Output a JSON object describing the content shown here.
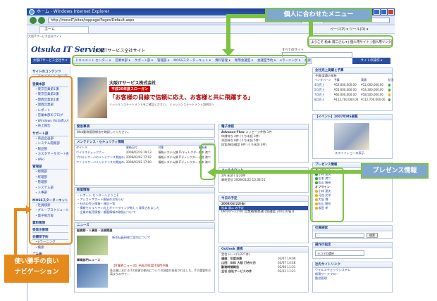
{
  "browser": {
    "title": "ホーム - Windows Internet Explorer",
    "url": "http://mossIT/sites/toppage/Pages/Default.aspx",
    "tab": "ホーム",
    "tools": "ページ(P) ▾  ツール(O) ▾"
  },
  "site": {
    "breadcrumb": "大阪ITサービス全社サイト",
    "logo": "Otsuka IT Service",
    "name": "大阪ITサービス全社サイト",
    "user_menu": "ようこそ 松本 満二さん ▾ | 個人用サイト | 個人用リンク ▾",
    "search_label": "すべてのサイト",
    "home_label": "大阪ITサービス全社サイト",
    "right_button": "サイトの操作 ▾"
  },
  "topnav": [
    "ドキュメント センター ▾",
    "営業本部 ▾",
    "サポート部 ▾",
    "管理部 ▾",
    "MOSSスターターキット ▾",
    "資料管理 ▾",
    "専用会議室 ▾",
    "会議室予約 ▾",
    "eラーニング ▾",
    "検索"
  ],
  "leftnav": [
    {
      "section": "サイトのコンテンツ",
      "items": [
        "ドキュメント センター"
      ]
    },
    {
      "section": "営業本部",
      "items": [
        "東京営業第1課",
        "東京営業第2課",
        "関西営業第1課",
        "関西営業部",
        "レポート",
        "営業本部のブログ",
        "Windows Vista導入検討",
        "売上報告"
      ]
    },
    {
      "section": "サポート部",
      "items": [
        "商品企画部",
        "システム開発部",
        "製品部",
        "カスタマーサポート部",
        "Wiki"
      ]
    },
    {
      "section": "管理部",
      "items": [
        "総務部",
        "経理部",
        "管理部",
        "システム部",
        "人事部"
      ]
    },
    {
      "section": "MOSSスターターキット",
      "items": [
        "社員検索",
        "グループスケジュール",
        "電子掲示板"
      ]
    },
    {
      "section": "資料管理",
      "items": []
    },
    {
      "section": "受発注管理",
      "items": []
    },
    {
      "section": "会議室予約",
      "items": [
        "eラーニング",
        "検索"
      ]
    },
    {
      "section": "ごみ箱",
      "items": []
    }
  ],
  "banner": {
    "company": "大阪ITサービス株式会社",
    "slogan": "平成20年度スローガン",
    "quote": "「お客様の目線で信頼に応え、お客様と共に飛躍する」",
    "subtitle": "ミッションステートメントをご確認ください。  ミッションステートメント説明文へ"
  },
  "notice": {
    "title": "緊急事項",
    "body": "Web勤務管理報告を確認してください。"
  },
  "maintenance": {
    "title": "メンテナンス・セキュリティ情報",
    "columns": [
      "タイトル",
      "更新日付",
      "対象",
      "更新者"
    ],
    "rows": [
      [
        "ウイルスチェックナー",
        "2008/02/19 19:13",
        "情報システム課 IT/ディレクター",
        "松本 満二"
      ],
      [
        "プロキシサーバのメンテナンス実施のお知らせ",
        "2008/02/02 17:02",
        "情報システム課 ITディレクター",
        "小野 満二"
      ],
      [
        "ファイルサーバメンテナンスの実施のお知らせ",
        "2008/02/02 17:00",
        "情報システム課 ITディレクター",
        "松本 満二"
      ]
    ]
  },
  "newsinfo": {
    "title": "新着情報",
    "items": [
      "レポート センターへようこそ",
      "アシストサポート開始のお知らせ",
      "社内の売上情報・報告一覧",
      "情報セキュリティ向上ガイドラインが新しく発表されました",
      "企業の販売情報・顧客情報の取扱について"
    ]
  },
  "news": {
    "title": "ニュース",
    "headline": "経費節・人事部・法務関連",
    "article": "新任社員研修ご案内について",
    "industry": "事業部門ニュース",
    "industry_headline": "【IT業界ニュース】平成20年度IT部門予算",
    "industry_body": "各企業におけるITの投資の動向についての調査が発表されました。ITの重要性の高まりの中で…"
  },
  "approval": {
    "title": "電子承認",
    "product": "Advance-Flow",
    "msg": "メッセージ件数 1件",
    "lines": [
      "申請待ち 4件 (うち未読 3件)",
      "承認待ち 8件 (うち未読 5件)",
      "回覧/報告確認 8件 (うち未読 3件)"
    ]
  },
  "mail": {
    "title": "メールカウント",
    "line1": "2件 未読 / 全20件",
    "line2": "最終受信 2008/02/22 10:38:51"
  },
  "schedule": {
    "title": "今日の予定",
    "date": "2008/02/22(金)",
    "user": "松本 満二 の予定",
    "event": "08:00～11:00 営業戦略会議 [会議室 201(10名)]"
  },
  "outlook": {
    "title": "Outlook 連携",
    "inbox": "受信トレイ(1/227件)",
    "rows": [
      [
        "連絡：年度決算",
        "03/07 19:09"
      ],
      [
        "山田：年休 大阪 打合せ日",
        "03/07 14:48"
      ],
      [
        "勤務時間報告",
        "03/06 11:31"
      ],
      [
        "全社 自社サービスの件",
        "02/22 11:21"
      ]
    ]
  },
  "sales": {
    "title": "全社売上実績と予算",
    "sub": "予算/実績の推移",
    "columns": [
      "インタバーン",
      "予算",
      "実績",
      "状況"
    ],
    "rows": [
      [
        "4月売上",
        "¥52,000,000.00",
        "¥52,000,000.00"
      ],
      [
        "5月売上",
        "¥53,000,000.00",
        "¥54,300,000.00"
      ],
      [
        "7月売上",
        "¥60,000,000.00",
        "¥58,500,000.00"
      ],
      [
        "8月売上",
        "¥112,700,000.00",
        "¥112,700,000.00"
      ]
    ],
    "status_colors": [
      "#3aa33a",
      "#3aa33a",
      "#e8b400",
      "#3aa33a"
    ]
  },
  "event": {
    "title": "【イベント】2007年MS展覧",
    "caption": "スライドショーの表示"
  },
  "presence": {
    "title": "プレゼンス情報",
    "online_label": "オンライン",
    "offline_label": "オフライン",
    "online": [
      "小林 達夫",
      "松本 満二",
      "松山 勝彦"
    ],
    "offline": [
      "小林 達夫",
      "河合 文学",
      "大坂 博",
      "松山 勝也",
      "坂田 孝"
    ]
  },
  "emp_search": {
    "title": "社員検索",
    "button": "検索"
  },
  "ops": {
    "title": "操作の指定",
    "select": "ラコマの選択"
  },
  "links": {
    "title": "社内サイトリンク",
    "items": [
      "ウイルスチェックシステム",
      "帳票ワークフロー",
      "勤怠管理"
    ]
  },
  "annotations": {
    "menu": "個人に合わせたメニュー",
    "presence": "プレゼンス情報",
    "navigation": "使い勝手の良い\nナビゲーション"
  },
  "colors": {
    "accent": "#7dc242",
    "callout": "#7fa8ce",
    "nav_callout": "#e6891b",
    "brand": "#1c3d8c"
  }
}
